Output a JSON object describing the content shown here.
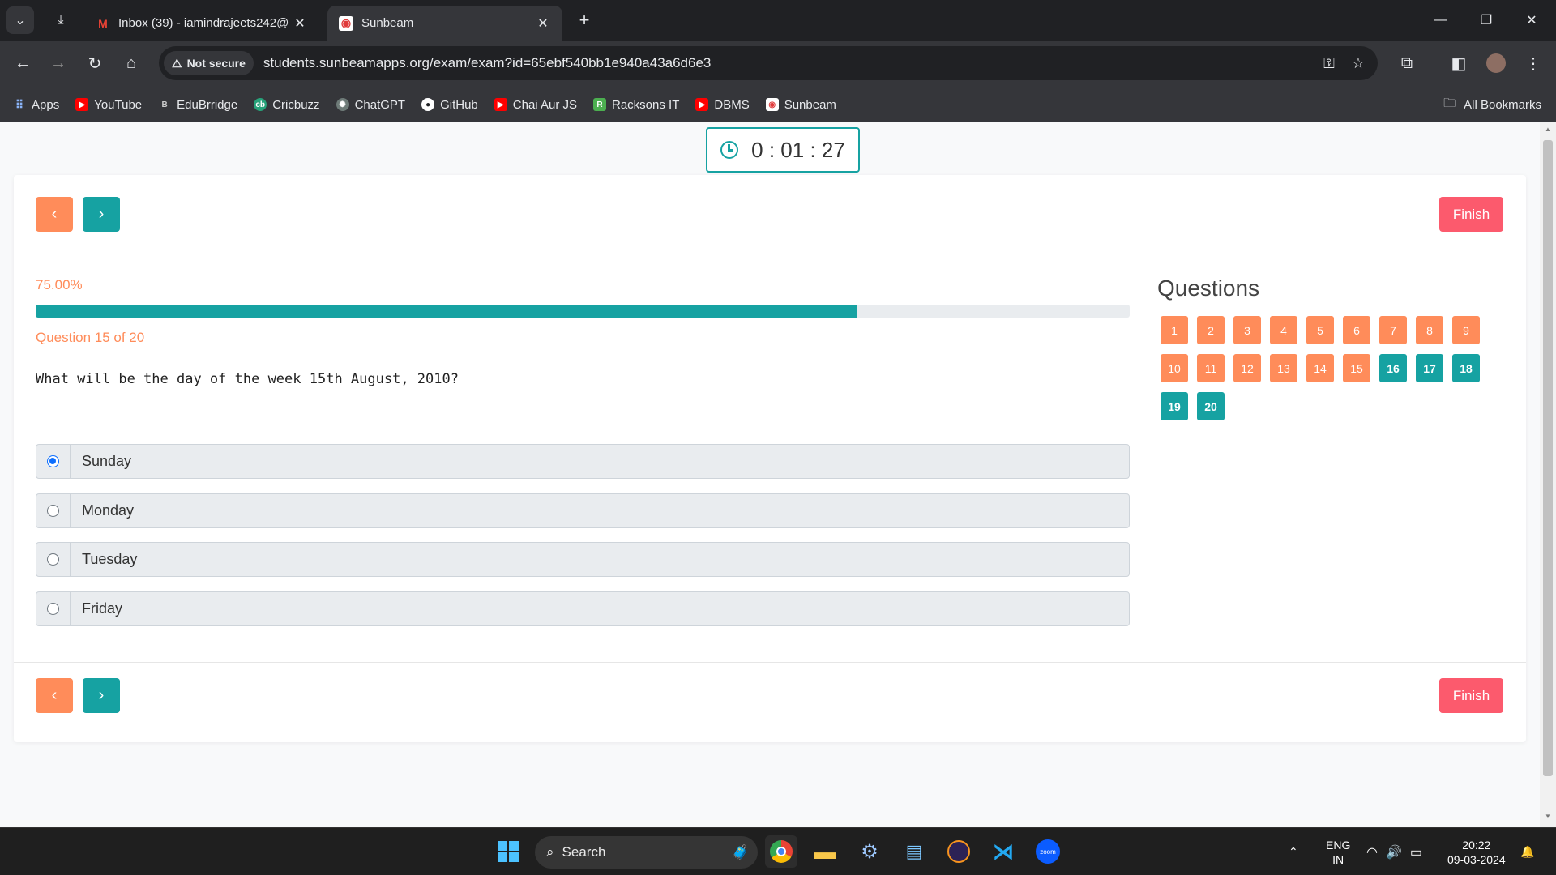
{
  "browser": {
    "tabs": [
      {
        "title": "Inbox (39) - iamindrajeets242@",
        "favicon": "gmail-icon",
        "active": false
      },
      {
        "title": "Sunbeam",
        "favicon": "sunbeam-icon",
        "active": true
      }
    ],
    "security_label": "Not secure",
    "url": "students.sunbeamapps.org/exam/exam?id=65ebf540bb1e940a43a6d6e3",
    "bookmarks": [
      {
        "label": "Apps",
        "icon": "apps-grid-icon"
      },
      {
        "label": "YouTube",
        "icon": "youtube-icon"
      },
      {
        "label": "EduBrridge",
        "icon": "edubridge-icon"
      },
      {
        "label": "Cricbuzz",
        "icon": "cricbuzz-icon"
      },
      {
        "label": "ChatGPT",
        "icon": "chatgpt-icon"
      },
      {
        "label": "GitHub",
        "icon": "github-icon"
      },
      {
        "label": "Chai Aur JS",
        "icon": "youtube-icon"
      },
      {
        "label": "Racksons IT",
        "icon": "racksons-icon"
      },
      {
        "label": "DBMS",
        "icon": "youtube-icon"
      },
      {
        "label": "Sunbeam",
        "icon": "sunbeam-icon"
      }
    ],
    "all_bookmarks_label": "All Bookmarks"
  },
  "exam": {
    "timer": "0 : 01 : 27",
    "progress_label": "75.00%",
    "progress_fraction": 0.75,
    "question_counter": "Question 15 of 20",
    "question_text": "What will be the day of the week 15th August, 2010?",
    "options": [
      {
        "label": "Sunday",
        "selected": true
      },
      {
        "label": "Monday",
        "selected": false
      },
      {
        "label": "Tuesday",
        "selected": false
      },
      {
        "label": "Friday",
        "selected": false
      }
    ],
    "finish_label": "Finish",
    "prev_symbol": "‹",
    "next_symbol": "›",
    "questions_heading": "Questions",
    "question_numbers": [
      {
        "n": "1",
        "state": "answered"
      },
      {
        "n": "2",
        "state": "answered"
      },
      {
        "n": "3",
        "state": "answered"
      },
      {
        "n": "4",
        "state": "answered"
      },
      {
        "n": "5",
        "state": "answered"
      },
      {
        "n": "6",
        "state": "answered"
      },
      {
        "n": "7",
        "state": "answered"
      },
      {
        "n": "8",
        "state": "answered"
      },
      {
        "n": "9",
        "state": "answered"
      },
      {
        "n": "10",
        "state": "answered"
      },
      {
        "n": "11",
        "state": "answered"
      },
      {
        "n": "12",
        "state": "answered"
      },
      {
        "n": "13",
        "state": "answered"
      },
      {
        "n": "14",
        "state": "answered"
      },
      {
        "n": "15",
        "state": "answered"
      },
      {
        "n": "16",
        "state": "pending"
      },
      {
        "n": "17",
        "state": "pending"
      },
      {
        "n": "18",
        "state": "pending"
      },
      {
        "n": "19",
        "state": "pending"
      },
      {
        "n": "20",
        "state": "pending"
      }
    ],
    "colors": {
      "accent_orange": "#ff8c5a",
      "accent_teal": "#16a2a2",
      "finish_red": "#fc5a6d"
    }
  },
  "taskbar": {
    "search_label": "Search",
    "lang_top": "ENG",
    "lang_bottom": "IN",
    "time": "20:22",
    "date": "09-03-2024"
  }
}
